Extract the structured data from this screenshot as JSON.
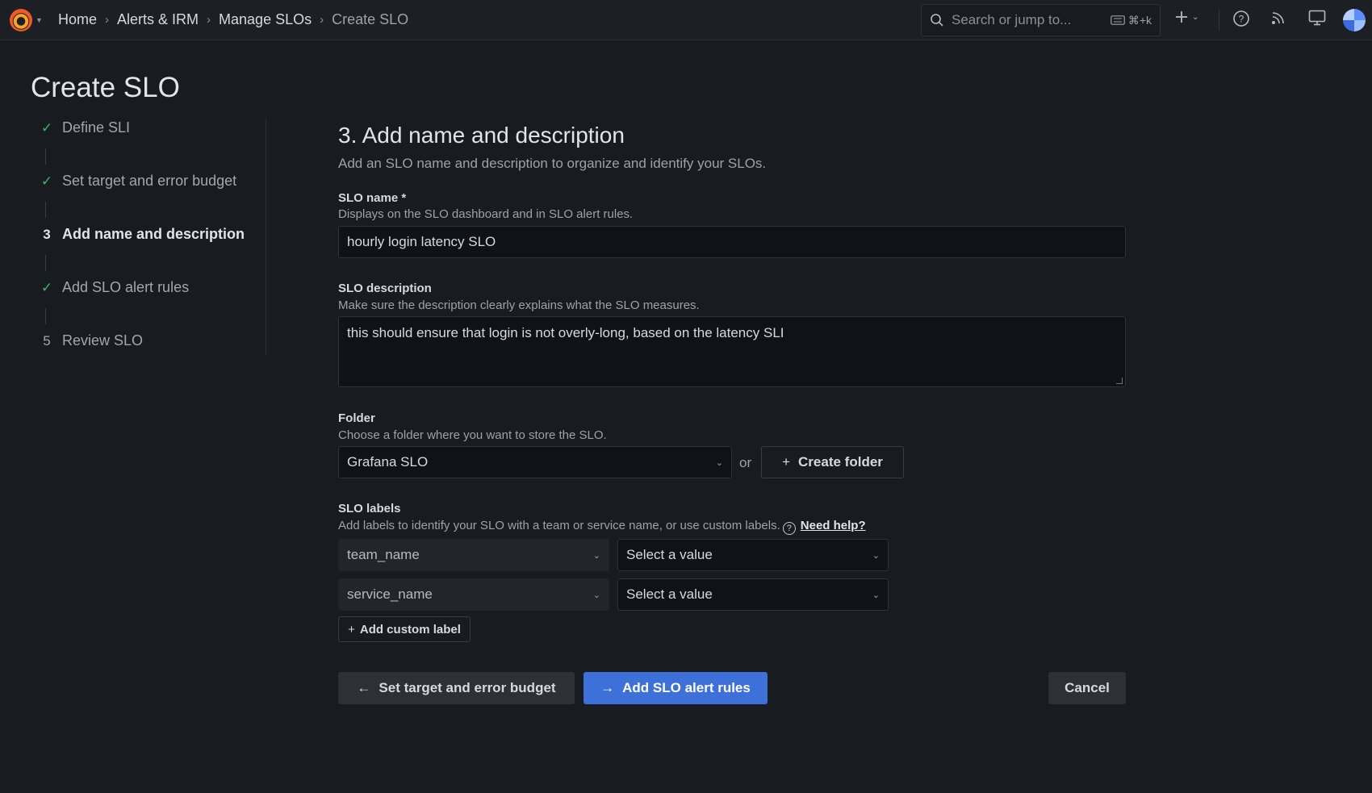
{
  "breadcrumb": [
    "Home",
    "Alerts & IRM",
    "Manage SLOs",
    "Create SLO"
  ],
  "search": {
    "placeholder": "Search or jump to...",
    "shortcut": "⌘+k"
  },
  "page_title": "Create SLO",
  "steps": [
    {
      "marker": "✓",
      "label": "Define SLI",
      "state": "done"
    },
    {
      "marker": "✓",
      "label": "Set target and error budget",
      "state": "done"
    },
    {
      "marker": "3",
      "label": "Add name and description",
      "state": "active"
    },
    {
      "marker": "✓",
      "label": "Add SLO alert rules",
      "state": "done"
    },
    {
      "marker": "5",
      "label": "Review SLO",
      "state": "pending"
    }
  ],
  "section": {
    "title": "3. Add name and description",
    "subtitle": "Add an SLO name and description to organize and identify your SLOs."
  },
  "slo_name": {
    "label": "SLO name *",
    "hint": "Displays on the SLO dashboard and in SLO alert rules.",
    "value": "hourly login latency SLO"
  },
  "slo_description": {
    "label": "SLO description",
    "hint": "Make sure the description clearly explains what the SLO measures.",
    "value": "this should ensure that login is not overly-long, based on the latency SLI"
  },
  "folder": {
    "label": "Folder",
    "hint": "Choose a folder where you want to store the SLO.",
    "value": "Grafana SLO",
    "or": "or",
    "create_label": "Create folder"
  },
  "labels": {
    "label": "SLO labels",
    "hint": "Add labels to identify your SLO with a team or service name, or use custom labels.",
    "help_link": "Need help?",
    "rows": [
      {
        "key": "team_name",
        "value_placeholder": "Select a value"
      },
      {
        "key": "service_name",
        "value_placeholder": "Select a value"
      }
    ],
    "add_custom": "Add custom label"
  },
  "actions": {
    "back": "Set target and error budget",
    "next": "Add SLO alert rules",
    "cancel": "Cancel"
  },
  "colors": {
    "primary": "#3d71d9",
    "check": "#3bb56a",
    "background": "#181b1f"
  }
}
